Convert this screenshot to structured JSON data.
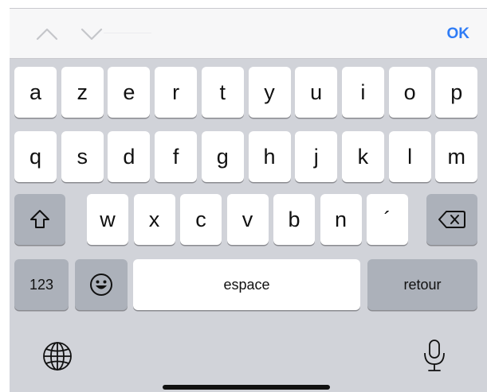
{
  "toolbar": {
    "done_label": "OK",
    "prev_icon": "chevron-up-icon",
    "next_icon": "chevron-down-icon"
  },
  "keyboard": {
    "row1": [
      "a",
      "z",
      "e",
      "r",
      "t",
      "y",
      "u",
      "i",
      "o",
      "p"
    ],
    "row2": [
      "q",
      "s",
      "d",
      "f",
      "g",
      "h",
      "j",
      "k",
      "l",
      "m"
    ],
    "row3": [
      "w",
      "x",
      "c",
      "v",
      "b",
      "n",
      "´"
    ],
    "shift_icon": "shift-icon",
    "delete_icon": "delete-icon",
    "numbers_label": "123",
    "emoji_icon": "emoji-icon",
    "space_label": "espace",
    "return_label": "retour",
    "globe_icon": "globe-icon",
    "mic_icon": "microphone-icon"
  },
  "colors": {
    "keyboard_bg": "#d1d3d9",
    "key_bg": "#ffffff",
    "special_key_bg": "#acb1ba",
    "accent": "#2f7cf6"
  }
}
